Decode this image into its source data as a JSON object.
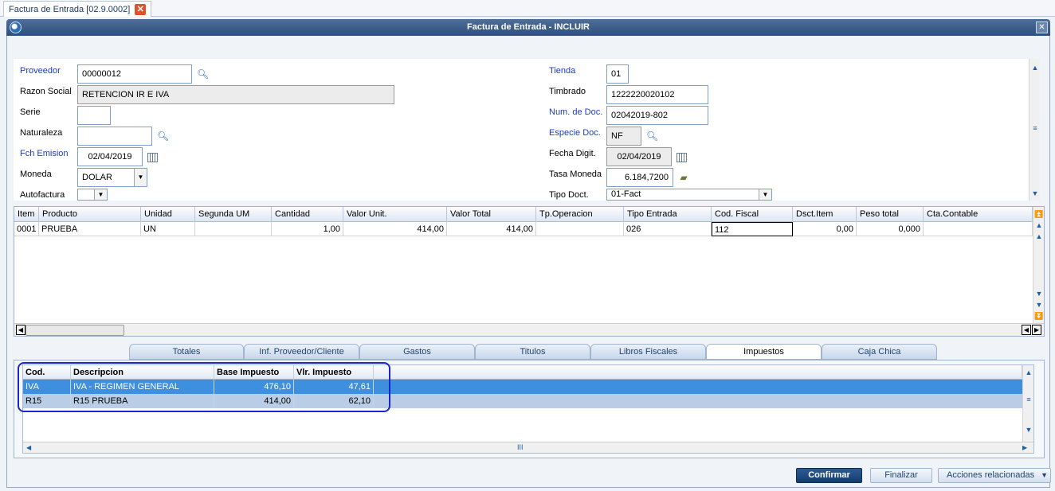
{
  "doc_tab": {
    "label": "Factura de Entrada [02.9.0002]",
    "close": "✕"
  },
  "window": {
    "title": "Factura de Entrada - INCLUIR",
    "close": "✕"
  },
  "header": {
    "proveedor": {
      "label": "Proveedor",
      "value": "00000012"
    },
    "razon_social": {
      "label": "Razon Social",
      "value": "RETENCION IR E IVA"
    },
    "serie": {
      "label": "Serie",
      "value": ""
    },
    "naturaleza": {
      "label": "Naturaleza",
      "value": ""
    },
    "fch_emision": {
      "label": "Fch Emision",
      "value": "02/04/2019"
    },
    "moneda": {
      "label": "Moneda",
      "value": "DOLAR"
    },
    "autofactura": {
      "label": "Autofactura",
      "value": ""
    },
    "tienda": {
      "label": "Tienda",
      "value": "01"
    },
    "timbrado": {
      "label": "Timbrado",
      "value": "1222220020102"
    },
    "num_doc": {
      "label": "Num. de Doc.",
      "value": "02042019-802"
    },
    "especie_doc": {
      "label": "Especie Doc.",
      "value": "NF"
    },
    "fecha_digit": {
      "label": "Fecha Digit.",
      "value": "02/04/2019"
    },
    "tasa_moneda": {
      "label": "Tasa Moneda",
      "value": "6.184,7200"
    },
    "tipo_doct": {
      "label": "Tipo Doct.",
      "value": "01-Fact"
    }
  },
  "items_grid": {
    "columns": [
      "Item",
      "Producto",
      "Unidad",
      "Segunda UM",
      "Cantidad",
      "Valor Unit.",
      "Valor Total",
      "Tp.Operacion",
      "Tipo Entrada",
      "Cod. Fiscal",
      "Dsct.Item",
      "Peso total",
      "Cta.Contable"
    ],
    "rows": [
      [
        "0001",
        "PRUEBA",
        "UN",
        "",
        "1,00",
        "414,00",
        "414,00",
        "",
        "026",
        "112",
        "0,00",
        "0,000",
        ""
      ]
    ]
  },
  "folder_tabs": [
    "Totales",
    "Inf. Proveedor/Cliente",
    "Gastos",
    "Titulos",
    "Libros Fiscales",
    "Impuestos",
    "Caja Chica"
  ],
  "tax_grid": {
    "columns": [
      "Cod.",
      "Descripcion",
      "Base Impuesto",
      "Vlr. Impuesto"
    ],
    "rows": [
      [
        "IVA",
        "IVA - REGIMEN GENERAL",
        "476,10",
        "47,61"
      ],
      [
        "R15",
        "R15 PRUEBA",
        "414,00",
        "62,10"
      ]
    ],
    "scroll_mark": "III"
  },
  "buttons": {
    "confirmar": "Confirmar",
    "finalizar": "Finalizar",
    "acciones": "Acciones relacionadas"
  },
  "colors": {
    "selected_row": "#3d8fe0",
    "second_row": "#b9cde6",
    "highlight": "#1b25c9",
    "primary": "#1e4a80"
  }
}
